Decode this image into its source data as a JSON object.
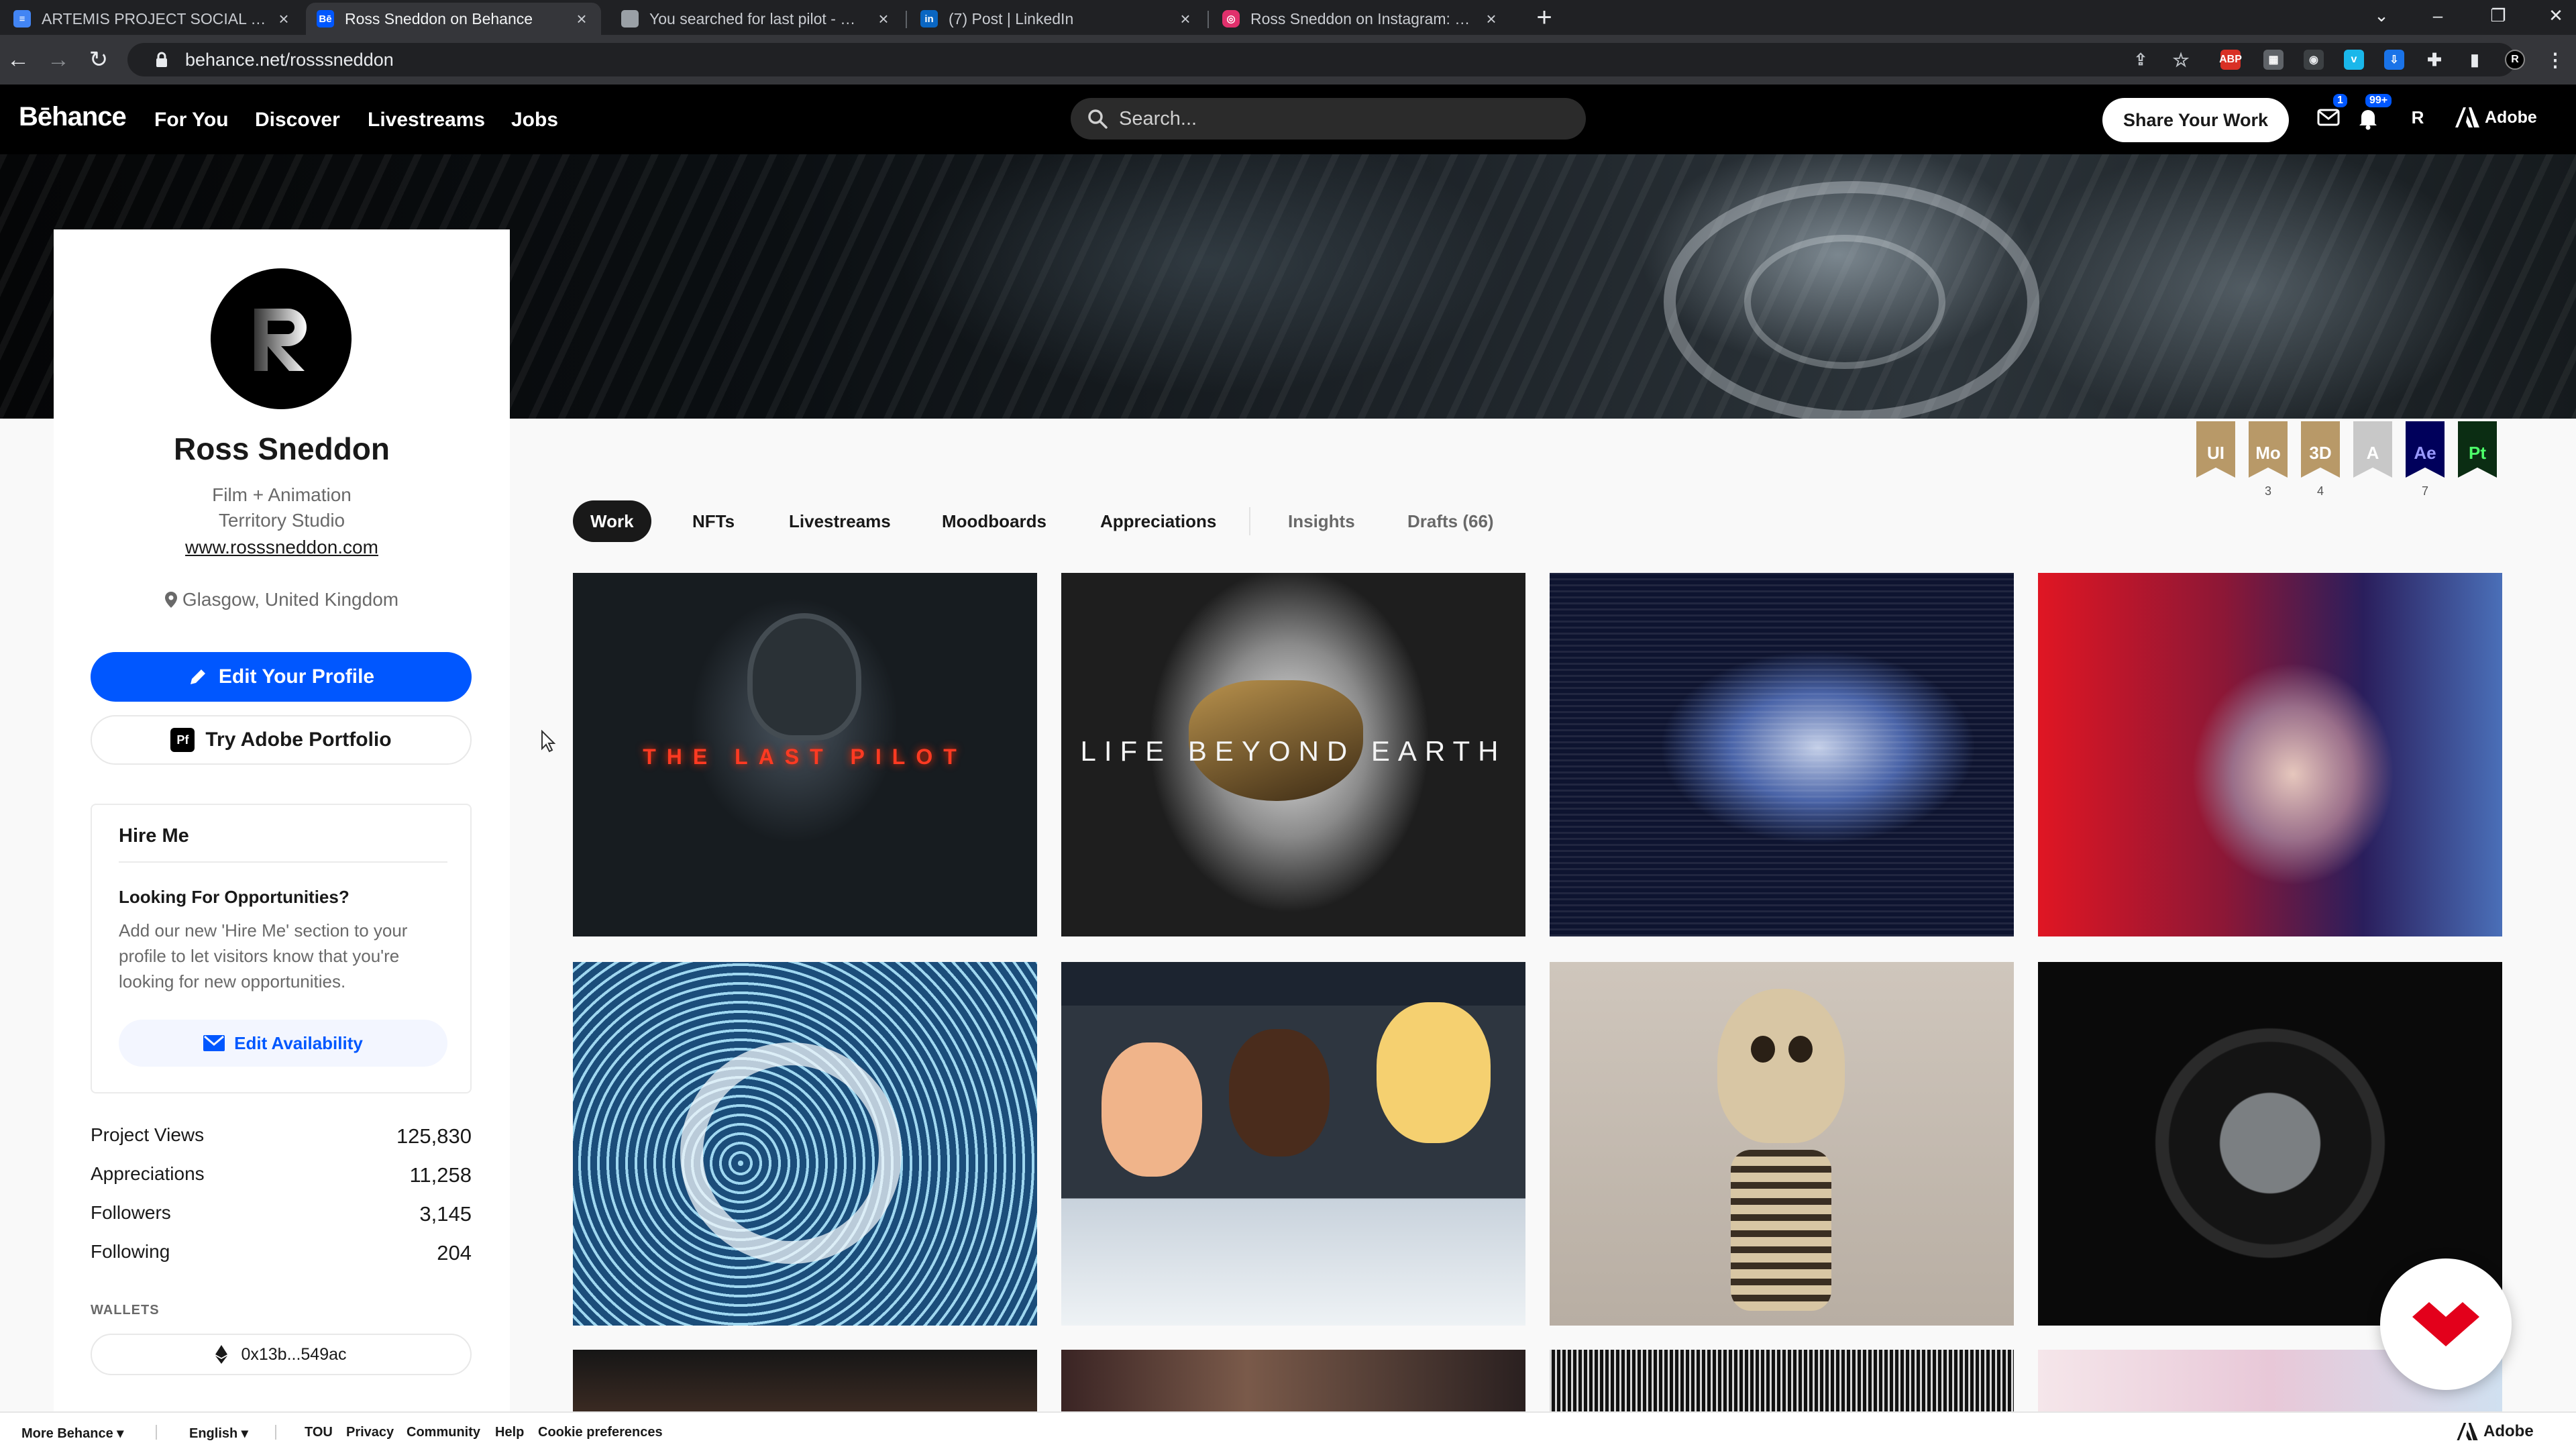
{
  "browser": {
    "tabs": [
      {
        "title": "ARTEMIS PROJECT SOCIAL - Goo",
        "favicon": "docs-icon",
        "color": "#4285f4"
      },
      {
        "title": "Ross Sneddon on Behance",
        "favicon": "behance-icon",
        "color": "#0057ff"
      },
      {
        "title": "You searched for last pilot - Moti",
        "favicon": "page-icon",
        "color": "#9aa0a6"
      },
      {
        "title": "(7) Post | LinkedIn",
        "favicon": "linkedin-icon",
        "color": "#0a66c2"
      },
      {
        "title": "Ross Sneddon on Instagram: \"Th",
        "favicon": "instagram-icon",
        "color": "#e1306c"
      }
    ],
    "url": "behance.net/rosssneddon",
    "ext_badge": "1"
  },
  "header": {
    "logo": "Bēhance",
    "nav": [
      "For You",
      "Discover",
      "Livestreams",
      "Jobs"
    ],
    "search_placeholder": "Search...",
    "share_label": "Share Your Work",
    "messages_badge": "1",
    "notifications_badge": "99+",
    "adobe_label": "Adobe"
  },
  "profile": {
    "name": "Ross Sneddon",
    "role": "Film + Animation",
    "company": "Territory Studio",
    "website": "www.rosssneddon.com",
    "location": "Glasgow, United Kingdom",
    "edit_label": "Edit Your Profile",
    "portfolio_label": "Try Adobe Portfolio",
    "hire": {
      "title": "Hire Me",
      "question": "Looking For Opportunities?",
      "description": "Add our new 'Hire Me' section to your profile to let visitors know that you're looking for new opportunities.",
      "button": "Edit Availability"
    },
    "stats": [
      {
        "label": "Project Views",
        "value": "125,830"
      },
      {
        "label": "Appreciations",
        "value": "11,258"
      },
      {
        "label": "Followers",
        "value": "3,145"
      },
      {
        "label": "Following",
        "value": "204"
      }
    ],
    "wallets_label": "WALLETS",
    "wallet": "0x13b...549ac"
  },
  "tools": [
    {
      "abbr": "UI",
      "count": "",
      "color": "#b89968"
    },
    {
      "abbr": "Mo",
      "count": "3",
      "color": "#b89968"
    },
    {
      "abbr": "3D",
      "count": "4",
      "color": "#b89968"
    },
    {
      "abbr": "A",
      "count": "",
      "color": "#c8c8c8"
    },
    {
      "abbr": "Ae",
      "count": "7",
      "color": "#00005b"
    },
    {
      "abbr": "Pt",
      "count": "",
      "color": "#0b2d13"
    }
  ],
  "tabs": [
    "Work",
    "NFTs",
    "Livestreams",
    "Moodboards",
    "Appreciations",
    "Insights",
    "Drafts (66)"
  ],
  "projects": [
    {
      "caption": "THE LAST PILOT"
    },
    {
      "caption": "LIFE BEYOND EARTH"
    }
  ],
  "footer": {
    "more": "More Behance",
    "lang": "English",
    "links": [
      "TOU",
      "Privacy",
      "Community",
      "Help",
      "Cookie preferences"
    ],
    "adobe": "Adobe"
  }
}
